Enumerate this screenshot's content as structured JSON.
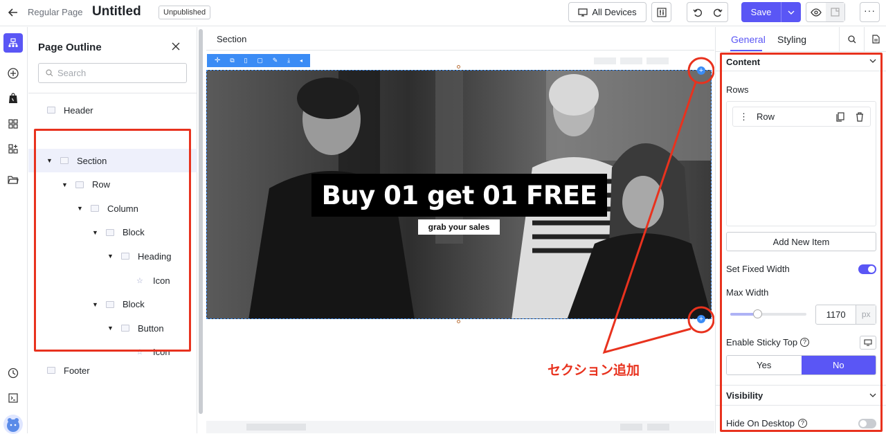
{
  "topbar": {
    "page_type": "Regular Page",
    "page_title": "Untitled",
    "status_badge": "Unpublished",
    "device_label": "All Devices",
    "save_label": "Save"
  },
  "outline": {
    "title": "Page Outline",
    "search_placeholder": "Search",
    "header_label": "Header",
    "footer_label": "Footer",
    "tree": [
      {
        "label": "Section",
        "depth": 0,
        "expanded": true
      },
      {
        "label": "Row",
        "depth": 1,
        "expanded": true
      },
      {
        "label": "Column",
        "depth": 2,
        "expanded": true
      },
      {
        "label": "Block",
        "depth": 3,
        "expanded": true
      },
      {
        "label": "Heading",
        "depth": 4,
        "expanded": true
      },
      {
        "label": "Icon",
        "depth": 5,
        "expanded": false
      },
      {
        "label": "Block",
        "depth": 3,
        "expanded": true
      },
      {
        "label": "Button",
        "depth": 4,
        "expanded": true
      },
      {
        "label": "Icon",
        "depth": 5,
        "expanded": false
      }
    ]
  },
  "canvas": {
    "breadcrumb": "Section",
    "hero_heading": "Buy 01 get 01 FREE",
    "hero_button": "grab your sales",
    "annotation": "セクション追加"
  },
  "panel": {
    "tabs": [
      "General",
      "Styling"
    ],
    "active_tab": "General",
    "content_title": "Content",
    "rows_label": "Rows",
    "row_item": "Row",
    "add_item": "Add New Item",
    "fixed_width_label": "Set Fixed Width",
    "fixed_width_on": true,
    "max_width_label": "Max Width",
    "max_width_value": "1170",
    "max_width_unit": "px",
    "sticky_label": "Enable Sticky Top",
    "yes_label": "Yes",
    "no_label": "No",
    "sticky_selected": "No",
    "visibility_title": "Visibility",
    "hide_desktop_label": "Hide On Desktop",
    "hide_desktop_on": false
  },
  "colors": {
    "accent": "#5a56f5",
    "annotation_red": "#e8321e",
    "toolbar_blue": "#3b8cf5"
  }
}
